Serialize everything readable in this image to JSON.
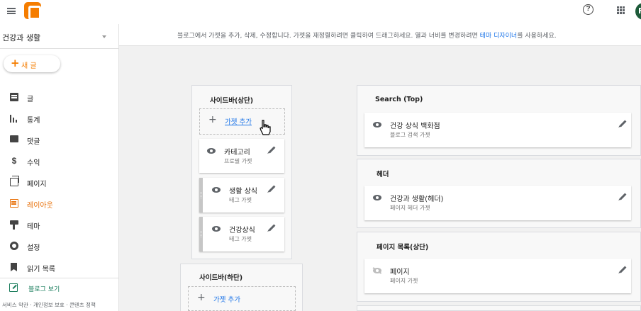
{
  "header": {
    "avatar_initial": "F"
  },
  "sidebar": {
    "blog_name": "건강과 생활",
    "new_post": "새 글",
    "items": [
      {
        "label": "글",
        "icon": "posts-icon"
      },
      {
        "label": "통계",
        "icon": "stats-icon"
      },
      {
        "label": "댓글",
        "icon": "comments-icon"
      },
      {
        "label": "수익",
        "icon": "earnings-icon"
      },
      {
        "label": "페이지",
        "icon": "pages-icon"
      },
      {
        "label": "레이아웃",
        "icon": "layout-icon",
        "active": true
      },
      {
        "label": "테마",
        "icon": "theme-icon"
      },
      {
        "label": "설정",
        "icon": "settings-icon"
      },
      {
        "label": "읽기 목록",
        "icon": "reading-list-icon"
      }
    ],
    "view_blog": "블로그 보기",
    "footer": "서비스 약관 · 개인정보 보호 · 콘텐츠 정책"
  },
  "info": {
    "text_before": "블로그에서 가젯을 추가, 삭제, 수정합니다. 가젯을 재정렬하려면 클릭하여 드래그하세요. 열과 너비를 변경하려면 ",
    "link": "테마 디자이너",
    "text_after": "를 사용하세요."
  },
  "layout": {
    "sidebar_top": {
      "title": "사이드바(상단)",
      "add_gadget": "가젯 추가",
      "gadgets": [
        {
          "title": "카테고리",
          "type": "프로필 가젯"
        },
        {
          "title": "생활 상식",
          "type": "태그 가젯"
        },
        {
          "title": "건강상식",
          "type": "태그 가젯"
        }
      ]
    },
    "sidebar_bottom": {
      "title": "사이드바(하단)",
      "add_gadget": "가젯 추가"
    },
    "search_top": {
      "title": "Search (Top)",
      "gadget": {
        "title": "건강 상식 백화점",
        "type": "블로그 검색 가젯"
      }
    },
    "header_sec": {
      "title": "헤더",
      "gadget": {
        "title": "건강과 생활(헤더)",
        "type": "페이지 헤더 가젯"
      }
    },
    "page_list": {
      "title": "페이지 목록(상단)",
      "gadget": {
        "title": "페이지",
        "type": "페이지 가젯"
      }
    }
  }
}
